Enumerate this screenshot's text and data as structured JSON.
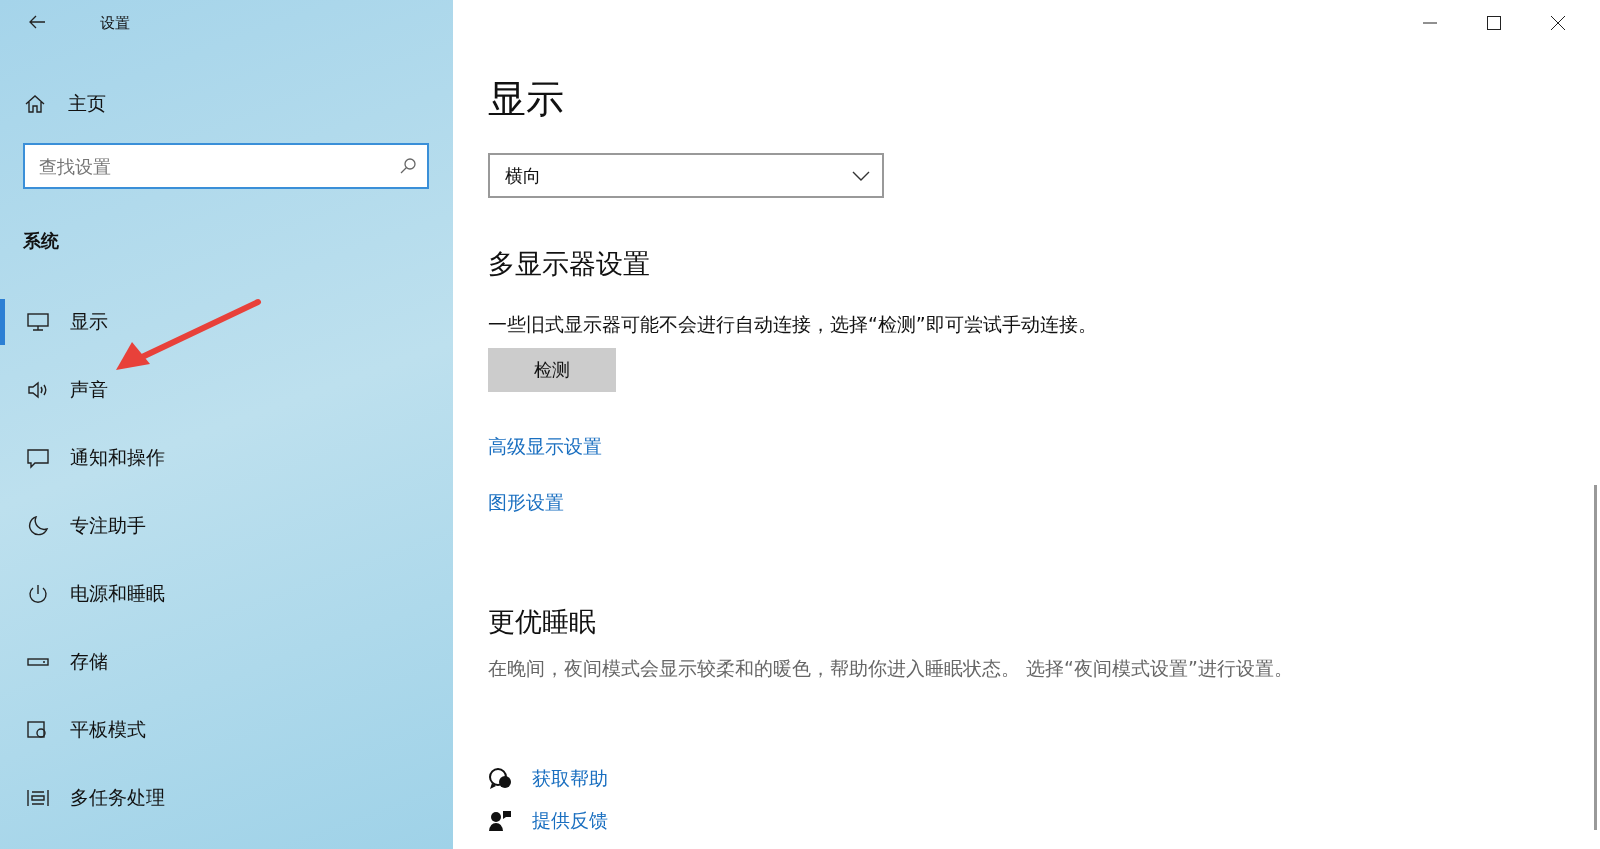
{
  "window": {
    "title": "设置"
  },
  "sidebar": {
    "home": "主页",
    "search": {
      "placeholder": "查找设置"
    },
    "section": "系统",
    "items": [
      {
        "label": "显示",
        "kind": "monitor",
        "selected": true
      },
      {
        "label": "声音",
        "kind": "speaker",
        "selected": false
      },
      {
        "label": "通知和操作",
        "kind": "message",
        "selected": false
      },
      {
        "label": "专注助手",
        "kind": "moon",
        "selected": false
      },
      {
        "label": "电源和睡眠",
        "kind": "power",
        "selected": false
      },
      {
        "label": "存储",
        "kind": "storage",
        "selected": false
      },
      {
        "label": "平板模式",
        "kind": "tablet",
        "selected": false
      },
      {
        "label": "多任务处理",
        "kind": "multitask",
        "selected": false
      }
    ]
  },
  "main": {
    "title": "显示",
    "orientation": {
      "value": "横向"
    },
    "multi_display": {
      "heading": "多显示器设置",
      "text": "一些旧式显示器可能不会进行自动连接，选择“检测”即可尝试手动连接。",
      "button": "检测"
    },
    "links": [
      "高级显示设置",
      "图形设置"
    ],
    "sleep": {
      "heading": "更优睡眠",
      "text": "在晚间，夜间模式会显示较柔和的暖色，帮助你进入睡眠状态。 选择“夜间模式设置”进行设置。"
    },
    "help": [
      {
        "label": "获取帮助",
        "kind": "help"
      },
      {
        "label": "提供反馈",
        "kind": "feedback"
      }
    ]
  }
}
